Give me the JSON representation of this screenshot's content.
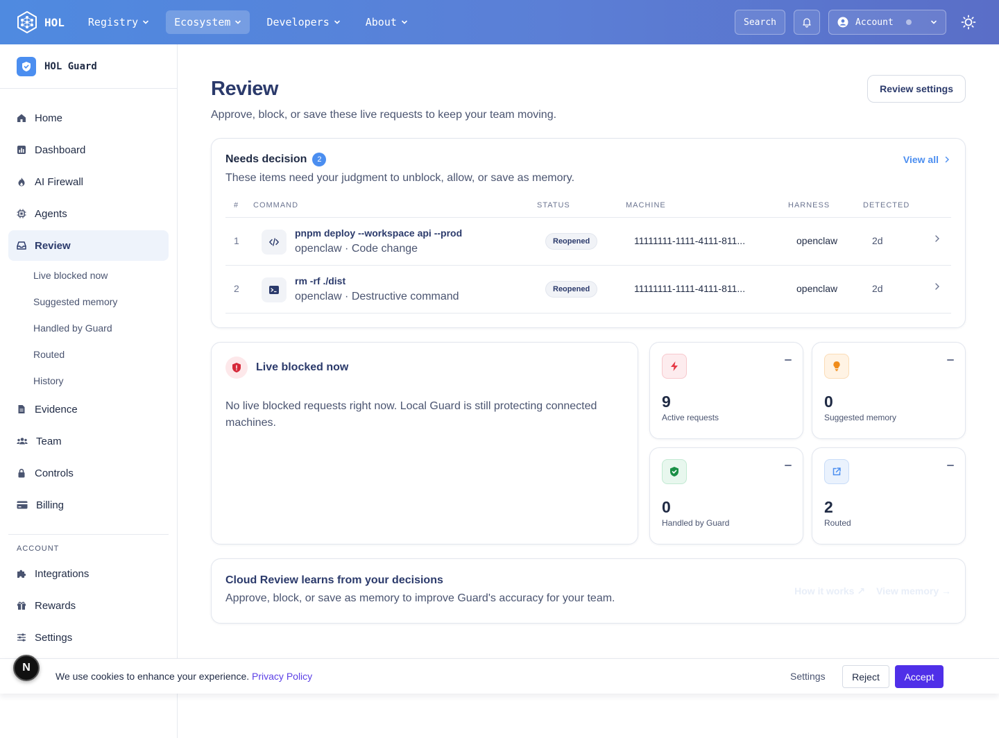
{
  "topnav": {
    "logo_text": "HOL",
    "items": [
      {
        "label": "Registry",
        "active": false
      },
      {
        "label": "Ecosystem",
        "active": true
      },
      {
        "label": "Developers",
        "active": false
      },
      {
        "label": "About",
        "active": false
      }
    ],
    "search_label": "Search",
    "account_label": "Account"
  },
  "sidebar": {
    "brand": "HOL Guard",
    "items": [
      {
        "label": "Home",
        "icon": "home-icon"
      },
      {
        "label": "Dashboard",
        "icon": "chart-icon"
      },
      {
        "label": "AI Firewall",
        "icon": "flame-icon"
      },
      {
        "label": "Agents",
        "icon": "chip-icon"
      },
      {
        "label": "Review",
        "icon": "inbox-icon",
        "active": true
      }
    ],
    "review_subitems": [
      "Live blocked now",
      "Suggested memory",
      "Handled by Guard",
      "Routed",
      "History"
    ],
    "items2": [
      {
        "label": "Evidence",
        "icon": "document-icon"
      },
      {
        "label": "Team",
        "icon": "users-icon"
      },
      {
        "label": "Controls",
        "icon": "lock-icon"
      },
      {
        "label": "Billing",
        "icon": "card-icon"
      }
    ],
    "account_section": "ACCOUNT",
    "account_items": [
      {
        "label": "Integrations",
        "icon": "puzzle-icon"
      },
      {
        "label": "Rewards",
        "icon": "gift-icon"
      },
      {
        "label": "Settings",
        "icon": "sliders-icon"
      }
    ]
  },
  "page": {
    "title": "Review",
    "subtitle": "Approve, block, or save these live requests to keep your team moving.",
    "settings_button": "Review settings"
  },
  "needs_decision": {
    "title": "Needs decision",
    "count": "2",
    "view_all": "View all",
    "subtitle": "These items need your judgment to unblock, allow, or save as memory.",
    "columns": [
      "#",
      "COMMAND",
      "STATUS",
      "MACHINE",
      "HARNESS",
      "DETECTED"
    ],
    "rows": [
      {
        "num": "1",
        "command": "pnpm deploy --workspace api --prod",
        "meta": "openclaw · Code change",
        "status": "Reopened",
        "machine": "11111111-1111-4111-811...",
        "harness": "openclaw",
        "detected": "2d",
        "icon": "code-icon"
      },
      {
        "num": "2",
        "command": "rm -rf ./dist",
        "meta": "openclaw · Destructive command",
        "status": "Reopened",
        "machine": "11111111-1111-4111-811...",
        "harness": "openclaw",
        "detected": "2d",
        "icon": "terminal-icon"
      }
    ]
  },
  "live_blocked": {
    "title": "Live blocked now",
    "text": "No live blocked requests right now. Local Guard is still protecting connected machines."
  },
  "stats": [
    {
      "value": "9",
      "label": "Active requests",
      "icon": "bolt-icon",
      "color": "#e53946",
      "bg": "#fdecee"
    },
    {
      "value": "0",
      "label": "Suggested memory",
      "icon": "bulb-icon",
      "color": "#f08c1a",
      "bg": "#fff3e4"
    },
    {
      "value": "0",
      "label": "Handled by Guard",
      "icon": "shield-check-icon",
      "color": "#1a8f46",
      "bg": "#e8f7ee"
    },
    {
      "value": "2",
      "label": "Routed",
      "icon": "external-link-icon",
      "color": "#4b8ef0",
      "bg": "#eaf2fd"
    }
  ],
  "cloud": {
    "title": "Cloud Review learns from your decisions",
    "subtitle": "Approve, block, or save as memory to improve Guard's accuracy for your team.",
    "link1": "How it works ↗",
    "link2": "View memory →"
  },
  "cookie": {
    "text": "We use cookies to enhance your experience.",
    "privacy": "Privacy Policy",
    "settings": "Settings",
    "reject": "Reject",
    "accept": "Accept"
  },
  "next_badge": "N"
}
